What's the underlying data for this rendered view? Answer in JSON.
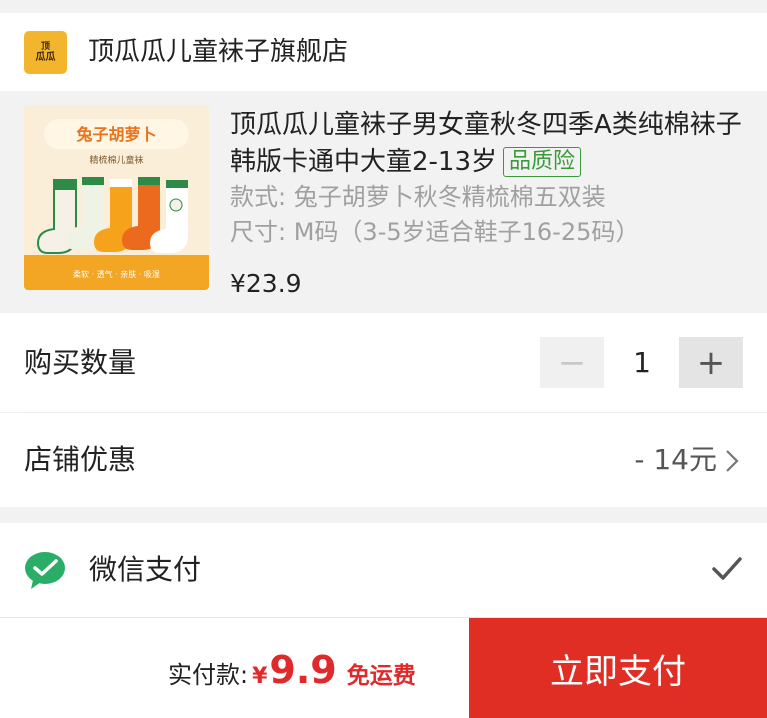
{
  "shop": {
    "logo_line1": "顶",
    "logo_line2": "瓜瓜",
    "name": "顶瓜瓜儿童袜子旗舰店"
  },
  "product": {
    "image_title": "兔子胡萝卜",
    "image_subtitle": "精梳棉儿童袜",
    "image_footer": "柔软 · 透气 · 亲肤 · 吸湿",
    "title": "顶瓜瓜儿童袜子男女童秋冬四季A类纯棉袜子韩版卡通中大童2-13岁",
    "badge": "品质险",
    "style": "款式: 兔子胡萝卜秋冬精梳棉五双装",
    "size": "尺寸: M码（3-5岁适合鞋子16-25码）",
    "price": "¥23.9"
  },
  "quantity": {
    "label": "购买数量",
    "minus": "−",
    "value": "1",
    "plus": "+"
  },
  "promo": {
    "label": "店铺优惠",
    "value": "- 14元"
  },
  "payment": {
    "method": "微信支付",
    "icon": "wechat-pay-icon",
    "selected": true
  },
  "footer": {
    "total_label": "实付款:",
    "currency": "¥",
    "amount": "9.9",
    "shipping": "免运费",
    "pay_button": "立即支付"
  },
  "colors": {
    "accent_red": "#e12e25",
    "wechat_green": "#2aae67",
    "badge_green": "#3a9a3a"
  }
}
